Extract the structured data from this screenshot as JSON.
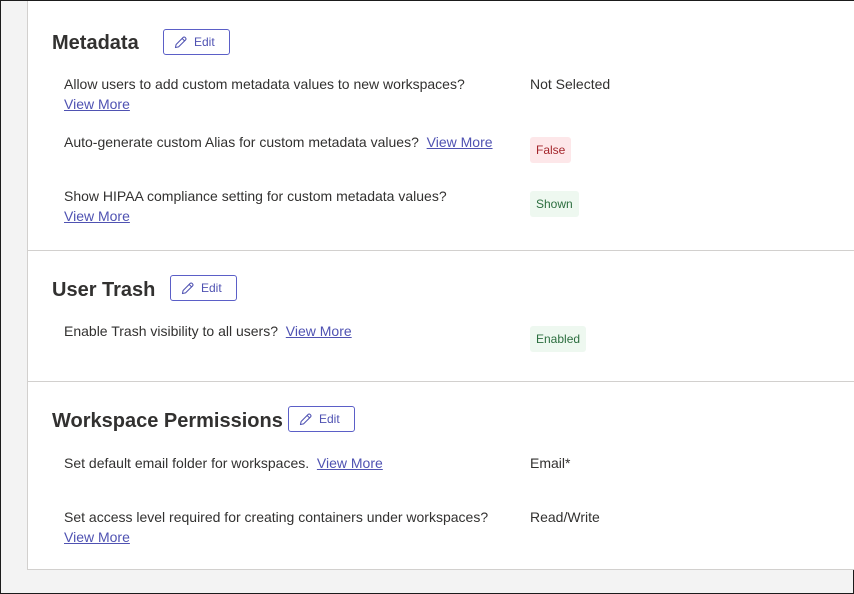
{
  "metadata": {
    "title": "Metadata",
    "edit_label": "Edit",
    "rows": [
      {
        "label": "Allow users to add custom metadata values to new workspaces?",
        "link": "View More",
        "value": "Not Selected"
      },
      {
        "label": "Auto-generate custom Alias for custom metadata values?",
        "link": "View More",
        "value": "False",
        "badge_bg": "#fde7e9"
      },
      {
        "label": "Show HIPAA compliance setting for custom metadata values?",
        "link": "View More",
        "value": "Shown",
        "badge_bg": "#eef8f0"
      }
    ]
  },
  "user_trash": {
    "title": "User Trash",
    "edit_label": "Edit",
    "rows": [
      {
        "label": "Enable Trash visibility to all users?",
        "link": "View More",
        "value": "Enabled",
        "badge_bg": "#eef8f0"
      }
    ]
  },
  "workspace_permissions": {
    "title": "Workspace Permissions",
    "edit_label": "Edit",
    "rows": [
      {
        "label": "Set default email folder for workspaces.",
        "link": "View More",
        "value": "Email*"
      },
      {
        "label": "Set access level required for creating containers under workspaces?",
        "link": "View More",
        "value": "Read/Write"
      }
    ]
  },
  "colors": {
    "accent": "#5b5fc7",
    "link": "#4f52b2",
    "border": "#d2d0ce"
  },
  "icons": {
    "edit": "pencil-icon"
  }
}
